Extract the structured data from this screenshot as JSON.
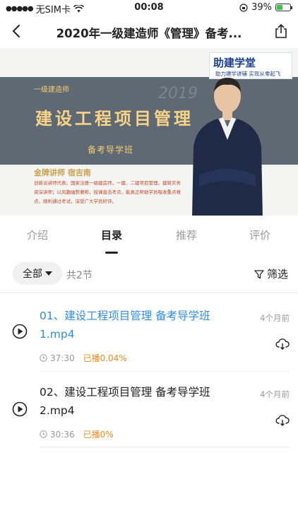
{
  "status": {
    "carrier": "无SIM卡",
    "time": "00:08",
    "battery": "39%"
  },
  "nav": {
    "title": "2020年一级建造师《管理》备考..."
  },
  "banner": {
    "logo": "助建学堂",
    "logo_sub": "助力建学讲辅  实现从零起飞",
    "small": "一级建造师",
    "year": "2019",
    "main": "建设工程项目管理",
    "sub": "备考导学班",
    "teacher": "金牌讲师  宿吉南",
    "line1": "创新派讲师代表，国家注册一级建造师，一建、二建项目管理，建筑实务",
    "line2": "资深讲师；以风趣幽默著称，授课直击考点，能真正帮助学员吸收重点难",
    "line3": "点，顺利通过考试，深受广大学员好评。"
  },
  "tabs": [
    "介绍",
    "目录",
    "推荐",
    "评价"
  ],
  "filter": {
    "all_label": "全部",
    "count": "共2节",
    "screen_label": "筛选"
  },
  "items": [
    {
      "name": "01、建设工程项目管理 备考导学班1.mp4",
      "duration": "37:30",
      "progress": "已播0.04%",
      "age": "4个月前"
    },
    {
      "name": "02、建设工程项目管理 备考导学班2.mp4",
      "duration": "30:36",
      "progress": "已播0%",
      "age": "4个月前"
    }
  ],
  "colors": {
    "accent": "#2f8ee4",
    "progress": "#f08c1f"
  }
}
